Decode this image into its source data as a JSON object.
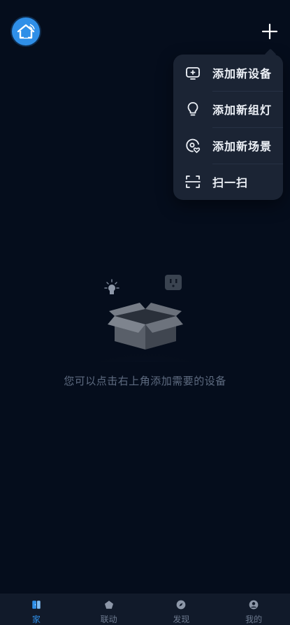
{
  "header": {
    "home_icon": "house-wifi-icon",
    "add_icon": "plus-icon"
  },
  "dropdown": {
    "items": [
      {
        "label": "添加新设备",
        "icon": "device-plus-icon"
      },
      {
        "label": "添加新组灯",
        "icon": "bulb-icon"
      },
      {
        "label": "添加新场景",
        "icon": "scene-icon"
      },
      {
        "label": "扫一扫",
        "icon": "scan-icon"
      }
    ]
  },
  "empty_state": {
    "message": "您可以点击右上角添加需要的设备"
  },
  "bottom_nav": {
    "items": [
      {
        "label": "家",
        "icon": "home-door-icon",
        "active": true
      },
      {
        "label": "联动",
        "icon": "pentagon-icon",
        "active": false
      },
      {
        "label": "发现",
        "icon": "compass-icon",
        "active": false
      },
      {
        "label": "我的",
        "icon": "user-icon",
        "active": false
      }
    ]
  },
  "colors": {
    "background": "#050d1c",
    "menu_background": "#1b2434",
    "accent": "#2f8fe8",
    "muted_text": "#5e6b80"
  }
}
